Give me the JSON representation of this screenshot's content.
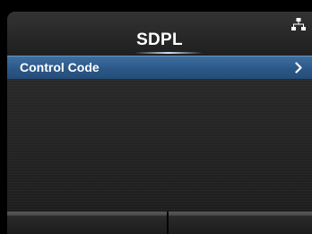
{
  "header": {
    "title": "SDPL",
    "status_icon": "network-icon"
  },
  "menu": {
    "items": [
      {
        "label": "Control Code",
        "selected": true,
        "icon": "chevron-right-icon"
      }
    ]
  },
  "softkeys": {
    "left_label": "",
    "right_label": ""
  },
  "colors": {
    "background": "#000000",
    "panel": "#262626",
    "selection": "#2b5888",
    "text": "#ffffff"
  }
}
